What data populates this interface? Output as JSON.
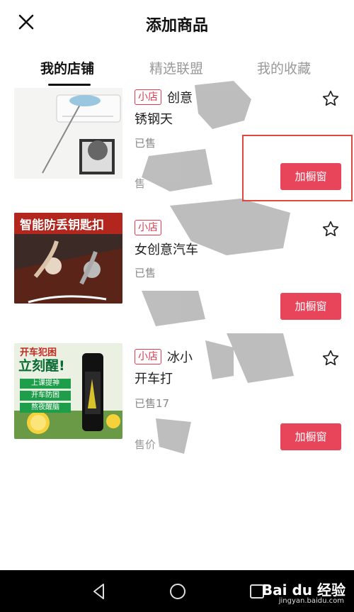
{
  "header": {
    "title": "添加商品"
  },
  "tabs": [
    {
      "label": "我的店铺",
      "active": true
    },
    {
      "label": "精选联盟",
      "active": false
    },
    {
      "label": "我的收藏",
      "active": false
    }
  ],
  "products": [
    {
      "badge": "小店",
      "name_line1": "创意",
      "name_line2": "锈钢天",
      "sold": "已售",
      "price": "售",
      "button": "加橱窗",
      "thumb_text": ""
    },
    {
      "badge": "小店",
      "name_line1": "",
      "name_line2": "女创意汽车",
      "sold": "已售",
      "price": "",
      "button": "加橱窗",
      "thumb_text": "智能防丢钥匙扣",
      "thumb_accent": "防丢"
    },
    {
      "badge": "小店",
      "name_line1": "冰小",
      "name_line2": "开车打",
      "sold": "已售17",
      "price": "售价",
      "button": "加橱窗",
      "thumb_text": "开车犯困",
      "thumb_text2": "立刻醒!",
      "thumb_tags": [
        "上课提神",
        "开车防困",
        "熬夜醒脑"
      ]
    }
  ],
  "watermark": {
    "brand": "Bai du 经验",
    "url": "jingyan.baidu.com"
  },
  "colors": {
    "accent": "#e8455b",
    "highlight": "#e0483e"
  }
}
